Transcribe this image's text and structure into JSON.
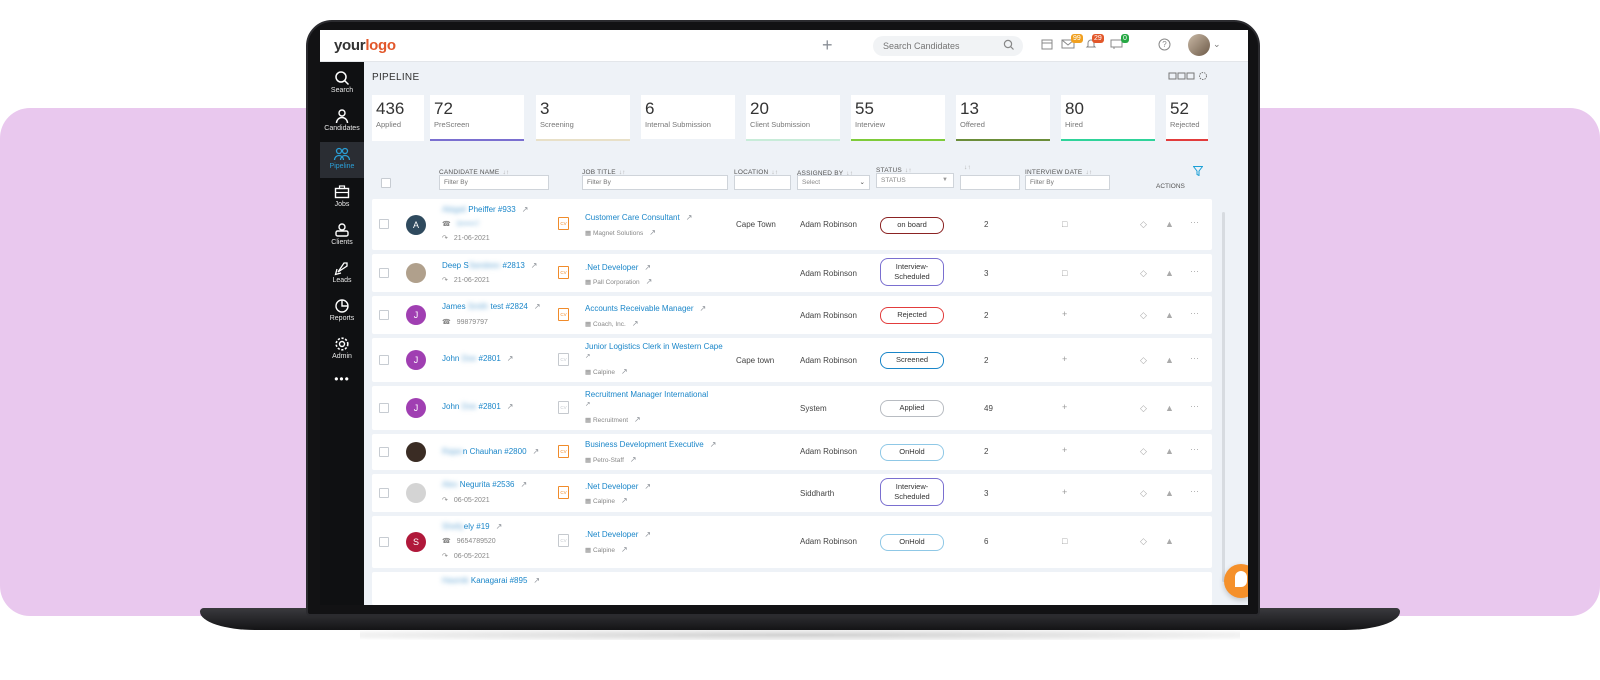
{
  "brand": {
    "logo_main": "your",
    "logo_accent": "logo"
  },
  "topbar": {
    "search_placeholder": "Search Candidates",
    "mail_badge": "99",
    "bell_badge": "29",
    "chat_badge": "0"
  },
  "sidebar": {
    "items": [
      {
        "label": "Search",
        "icon": "search-icon"
      },
      {
        "label": "Candidates",
        "icon": "user-icon"
      },
      {
        "label": "Pipeline",
        "icon": "pipeline-icon"
      },
      {
        "label": "Jobs",
        "icon": "briefcase-icon"
      },
      {
        "label": "Clients",
        "icon": "clients-icon"
      },
      {
        "label": "Leads",
        "icon": "rocket-icon"
      },
      {
        "label": "Reports",
        "icon": "pie-chart-icon"
      },
      {
        "label": "Admin",
        "icon": "gear-icon"
      }
    ],
    "more": "•••"
  },
  "page": {
    "title": "PIPELINE"
  },
  "stats": [
    {
      "value": "436",
      "label": "Applied",
      "color": "#ffffff"
    },
    {
      "value": "72",
      "label": "PreScreen",
      "color": "#7a6fd0"
    },
    {
      "value": "3",
      "label": "Screening",
      "color": "#e8e0c8"
    },
    {
      "value": "6",
      "label": "Internal Submission",
      "color": "#eef2f7"
    },
    {
      "value": "20",
      "label": "Client Submission",
      "color": "#c8ecd9"
    },
    {
      "value": "55",
      "label": "Interview",
      "color": "#7ecb3a"
    },
    {
      "value": "13",
      "label": "Offered",
      "color": "#6b8d3a"
    },
    {
      "value": "80",
      "label": "Hired",
      "color": "#2fd39a"
    },
    {
      "value": "52",
      "label": "Rejected",
      "color": "#e23c3c"
    }
  ],
  "columns": {
    "candidate": "CANDIDATE NAME",
    "job": "JOB TITLE",
    "location": "LOCATION",
    "assigned": "ASSIGNED BY",
    "status": "STATUS",
    "interview": "INTERVIEW DATE",
    "actions": "ACTIONS",
    "sort_glyph": "↓↑"
  },
  "filters": {
    "candidate": "Filter By",
    "job": "Filter By",
    "assigned": "Select",
    "status": "STATUS",
    "interview": "Filter By"
  },
  "rows": [
    {
      "initial": "A",
      "avatar_color": "#2f4a5e",
      "name_hidden": "Abigail",
      "name": "Pheiffer #933",
      "phone": "0••••••7",
      "date": "21-06-2021",
      "cv": true,
      "job": "Customer Care Consultant",
      "company": "Magnet Solutions",
      "location": "Cape Town",
      "assigned": "Adam Robinson",
      "status": "on board",
      "status_color": "#8b2323",
      "count": "2",
      "doc": true
    },
    {
      "initial": "",
      "avatar_color": "#b0a08c",
      "name_hidden": "Sandeev",
      "name_pre": "Deep S",
      "name": "#2813",
      "phone": "",
      "date": "21-06-2021",
      "cv": true,
      "job": ".Net Developer",
      "company": "Pall Corporation",
      "location": "",
      "assigned": "Adam Robinson",
      "status": "Interview-Scheduled",
      "status_color": "#7a6fd0",
      "count": "3",
      "doc": true
    },
    {
      "initial": "J",
      "avatar_color": "#a03fb2",
      "name_hidden": "Smith",
      "name_pre": "James",
      "name": "test #2824",
      "phone": "99879797",
      "date": "",
      "cv": true,
      "job": "Accounts Receivable Manager",
      "company": "Coach, Inc.",
      "location": "",
      "assigned": "Adam Robinson",
      "status": "Rejected",
      "status_color": "#e23c3c",
      "count": "2",
      "doc": false
    },
    {
      "initial": "J",
      "avatar_color": "#a03fb2",
      "name_hidden": "Doe",
      "name_pre": "John",
      "name": "#2801",
      "phone": "",
      "date": "",
      "cv": false,
      "job": "Junior Logistics Clerk in Western Cape",
      "company": "Calpine",
      "location": "Cape town",
      "assigned": "Adam Robinson",
      "status": "Screened",
      "status_color": "#1a86c9",
      "count": "2",
      "doc": false
    },
    {
      "initial": "J",
      "avatar_color": "#a03fb2",
      "name_hidden": "Doe",
      "name_pre": "John",
      "name": "#2801",
      "phone": "",
      "date": "",
      "cv": false,
      "job": "Recruitment Manager International",
      "company": "Recruitment",
      "location": "",
      "assigned": "System",
      "status": "Applied",
      "status_color": "#b8bcc2",
      "count": "49",
      "doc": false
    },
    {
      "initial": "",
      "avatar_color": "#3a2c24",
      "name_hidden": "Rajan",
      "name_pre": "",
      "name": "n Chauhan #2800",
      "phone": "",
      "date": "",
      "cv": true,
      "job": "Business Development Executive",
      "company": "Petro-Staff",
      "location": "",
      "assigned": "Adam Robinson",
      "status": "OnHold",
      "status_color": "#8fc8e6",
      "count": "2",
      "doc": false
    },
    {
      "initial": "",
      "avatar_color": "#d4d4d4",
      "name_hidden": "Alex",
      "name_pre": "",
      "name": "Negurita #2536",
      "phone": "",
      "date": "06-05-2021",
      "cv": true,
      "job": ".Net Developer",
      "company": "Calpine",
      "location": "",
      "assigned": "Siddharth",
      "status": "Interview-Scheduled",
      "status_color": "#7a6fd0",
      "count": "3",
      "doc": false
    },
    {
      "initial": "S",
      "avatar_color": "#b0183a",
      "name_hidden": "Shelly",
      "name_pre": "",
      "name": "ely #19",
      "phone": "9654789520",
      "date": "06-05-2021",
      "cv": false,
      "job": ".Net Developer",
      "company": "Calpine",
      "location": "",
      "assigned": "Adam Robinson",
      "status": "OnHold",
      "status_color": "#8fc8e6",
      "count": "6",
      "doc": true
    },
    {
      "initial": "",
      "avatar_color": "#eef2f7",
      "name_hidden": "Hasmik",
      "name_pre": "",
      "name": "Kanagarai #895",
      "phone": "",
      "date": "",
      "cv": false,
      "job": "",
      "company": "",
      "location": "",
      "assigned": "",
      "status": "",
      "status_color": "#ffffff",
      "count": "",
      "doc": false
    }
  ]
}
